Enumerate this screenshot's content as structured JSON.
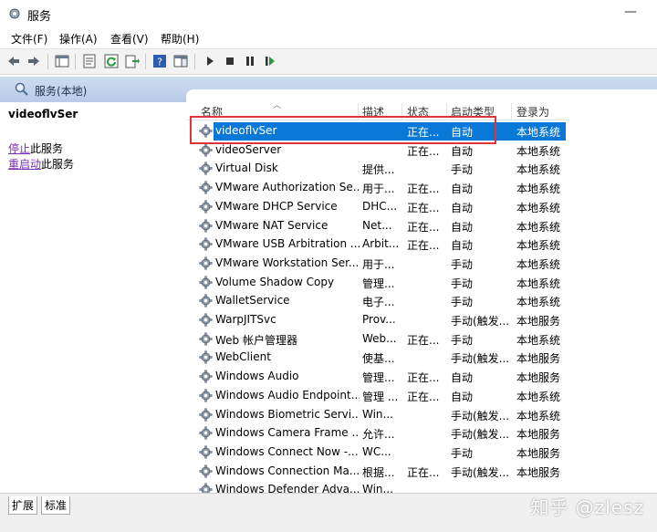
{
  "window": {
    "title": "服务",
    "minimize_glyph": "—"
  },
  "menu": [
    "文件(F)",
    "操作(A)",
    "查看(V)",
    "帮助(H)"
  ],
  "toolbar": {
    "icons": [
      "back-icon",
      "forward-icon",
      "console-tree-icon",
      "properties-icon",
      "refresh-icon",
      "export-icon",
      "help-icon",
      "show-hide-icon",
      "play-icon",
      "stop-icon",
      "pause-icon",
      "resume-icon"
    ]
  },
  "band": {
    "title": "服务(本地)"
  },
  "left": {
    "service_name": "videoflvSer",
    "stop_link": "停止",
    "stop_rest": "此服务",
    "restart_link": "重启动",
    "restart_rest": "此服务"
  },
  "columns": {
    "name": "名称",
    "desc": "描述",
    "state": "状态",
    "start": "启动类型",
    "logon": "登录为"
  },
  "rows": [
    {
      "name": "videoflvSer",
      "desc": "",
      "state": "正在...",
      "start": "自动",
      "logon": "本地系统"
    },
    {
      "name": "videoServer",
      "desc": "",
      "state": "正在...",
      "start": "自动",
      "logon": "本地系统"
    },
    {
      "name": "Virtual Disk",
      "desc": "提供...",
      "state": "",
      "start": "手动",
      "logon": "本地系统"
    },
    {
      "name": "VMware Authorization Se...",
      "desc": "用于...",
      "state": "正在...",
      "start": "自动",
      "logon": "本地系统"
    },
    {
      "name": "VMware DHCP Service",
      "desc": "DHC...",
      "state": "正在...",
      "start": "自动",
      "logon": "本地系统"
    },
    {
      "name": "VMware NAT Service",
      "desc": "Net...",
      "state": "正在...",
      "start": "自动",
      "logon": "本地系统"
    },
    {
      "name": "VMware USB Arbitration ...",
      "desc": "Arbit...",
      "state": "正在...",
      "start": "自动",
      "logon": "本地系统"
    },
    {
      "name": "VMware Workstation Ser...",
      "desc": "用于...",
      "state": "",
      "start": "手动",
      "logon": "本地系统"
    },
    {
      "name": "Volume Shadow Copy",
      "desc": "管理...",
      "state": "",
      "start": "手动",
      "logon": "本地系统"
    },
    {
      "name": "WalletService",
      "desc": "电子...",
      "state": "",
      "start": "手动",
      "logon": "本地系统"
    },
    {
      "name": "WarpJITSvc",
      "desc": "Prov...",
      "state": "",
      "start": "手动(触发...",
      "logon": "本地服务"
    },
    {
      "name": "Web 帐户管理器",
      "desc": "Web...",
      "state": "正在...",
      "start": "手动",
      "logon": "本地系统"
    },
    {
      "name": "WebClient",
      "desc": "使基...",
      "state": "",
      "start": "手动(触发...",
      "logon": "本地服务"
    },
    {
      "name": "Windows Audio",
      "desc": "管理...",
      "state": "正在...",
      "start": "自动",
      "logon": "本地服务"
    },
    {
      "name": "Windows Audio Endpoint...",
      "desc": "管理 ...",
      "state": "正在...",
      "start": "自动",
      "logon": "本地系统"
    },
    {
      "name": "Windows Biometric Servi...",
      "desc": "Win...",
      "state": "",
      "start": "手动(触发...",
      "logon": "本地系统"
    },
    {
      "name": "Windows Camera Frame ...",
      "desc": "允许...",
      "state": "",
      "start": "手动(触发...",
      "logon": "本地服务"
    },
    {
      "name": "Windows Connect Now -...",
      "desc": "WC...",
      "state": "",
      "start": "手动",
      "logon": "本地服务"
    },
    {
      "name": "Windows Connection Ma...",
      "desc": "根据...",
      "state": "正在...",
      "start": "手动(触发...",
      "logon": "本地服务"
    },
    {
      "name": "Windows Defender Adva...",
      "desc": "Win...",
      "state": "",
      "start": "",
      "logon": ""
    }
  ],
  "tabs": [
    "扩展",
    "标准"
  ],
  "watermark": "知乎 @zlesz",
  "colors": {
    "selection": "#0a78d7",
    "annotation_box": "#e0343a",
    "link": "#7b2fb0"
  }
}
